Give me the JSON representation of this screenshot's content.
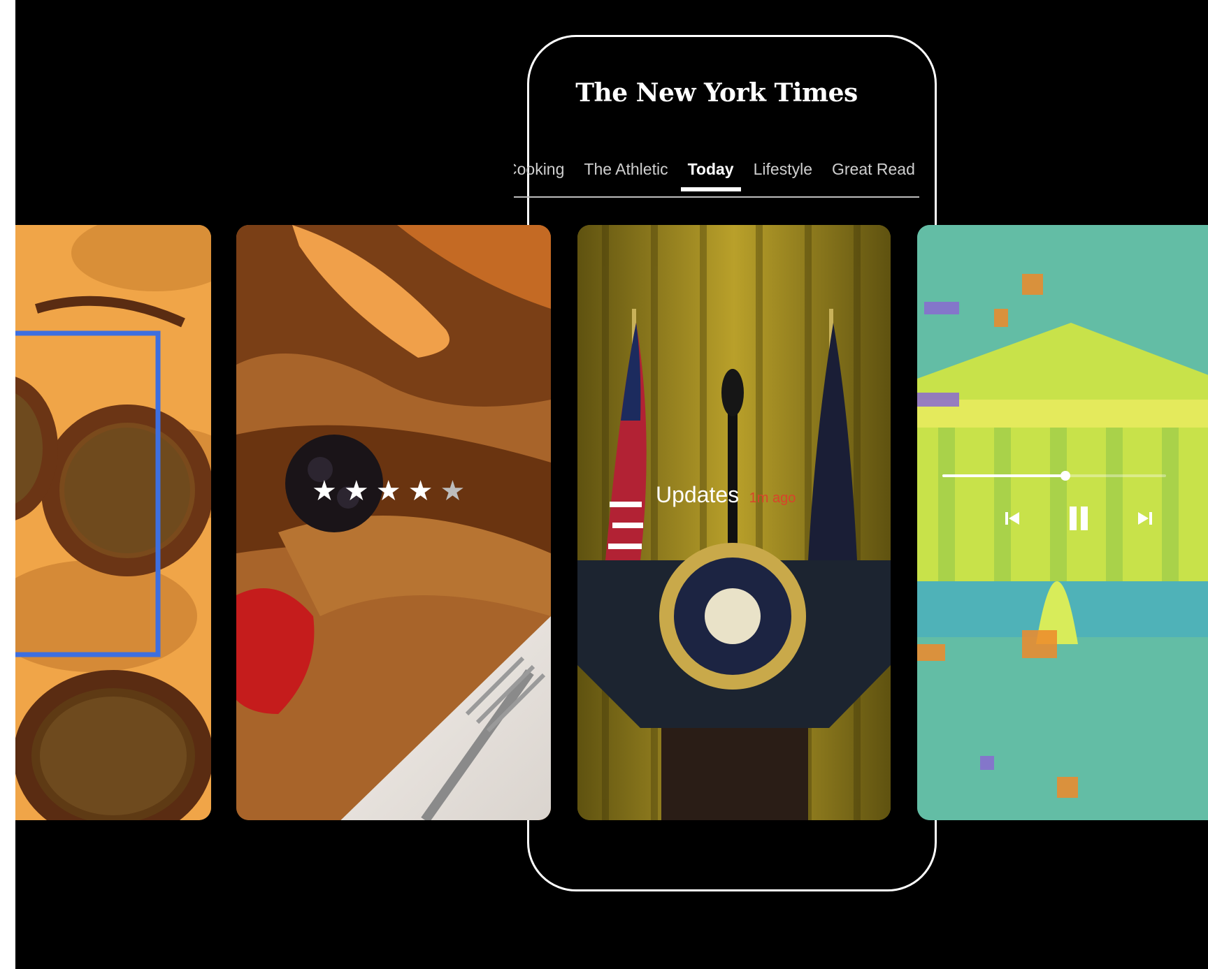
{
  "masthead": {
    "title": "The New York Times"
  },
  "tabs": [
    {
      "label": "Cooking",
      "active": false
    },
    {
      "label": "The Athletic",
      "active": false
    },
    {
      "label": "Today",
      "active": true
    },
    {
      "label": "Lifestyle",
      "active": false
    },
    {
      "label": "Great Read",
      "active": false
    }
  ],
  "review_card": {
    "rating": 4,
    "max_rating": 5
  },
  "news_card": {
    "label": "Updates",
    "timestamp": "1m ago"
  },
  "audio_card": {
    "progress": 0.55
  },
  "colors": {
    "background": "#000000",
    "frame": "#ffffff",
    "accent_blue": "#3d6fe0",
    "accent_red": "#d9432b"
  }
}
